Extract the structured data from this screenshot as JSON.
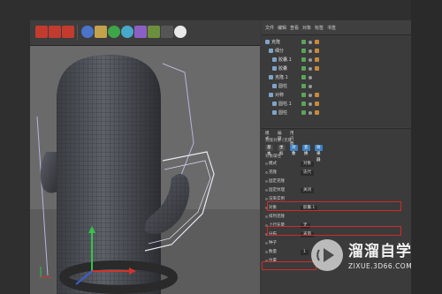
{
  "menubar": {
    "items": [
      "文件",
      "编辑",
      "查看",
      "对象",
      "标签",
      "书签"
    ]
  },
  "objects": [
    {
      "name": "克隆",
      "has_tag": true
    },
    {
      "name": "细分",
      "has_tag": true
    },
    {
      "name": "胶囊.1",
      "has_tag": true
    },
    {
      "name": "胶囊",
      "has_tag": true
    },
    {
      "name": "克隆.1",
      "has_tag": false
    },
    {
      "name": "圆柱",
      "has_tag": false
    },
    {
      "name": "对称",
      "has_tag": true
    },
    {
      "name": "圆柱.1",
      "has_tag": true
    },
    {
      "name": "圆柱",
      "has_tag": true
    }
  ],
  "attributes": {
    "tabs": [
      "模式",
      "编辑",
      "用户数据"
    ],
    "header": "克隆对象 [克隆]",
    "mode_buttons": [
      "基本",
      "坐标",
      "对象",
      "变换",
      "效果器"
    ],
    "section_object": "对象属性",
    "rows": [
      {
        "label": "模式",
        "value": "对象"
      },
      {
        "label": "克隆",
        "value": "迭代"
      },
      {
        "label": "固定克隆",
        "value": ""
      },
      {
        "label": "固定纹理",
        "value": "关闭"
      },
      {
        "label": "渲染实例",
        "value": ""
      },
      {
        "label": "对象",
        "value": "胶囊.1"
      },
      {
        "label": "排列克隆",
        "value": ""
      },
      {
        "label": "上行矢量",
        "value": "无"
      },
      {
        "label": "分布",
        "value": "表面"
      },
      {
        "label": "种子",
        "value": ""
      },
      {
        "label": "数量",
        "value": "1"
      },
      {
        "label": "位置",
        "value": ""
      }
    ]
  },
  "watermark": {
    "title": "溜溜自学",
    "url": "ZIXUE.3D66.COM"
  }
}
